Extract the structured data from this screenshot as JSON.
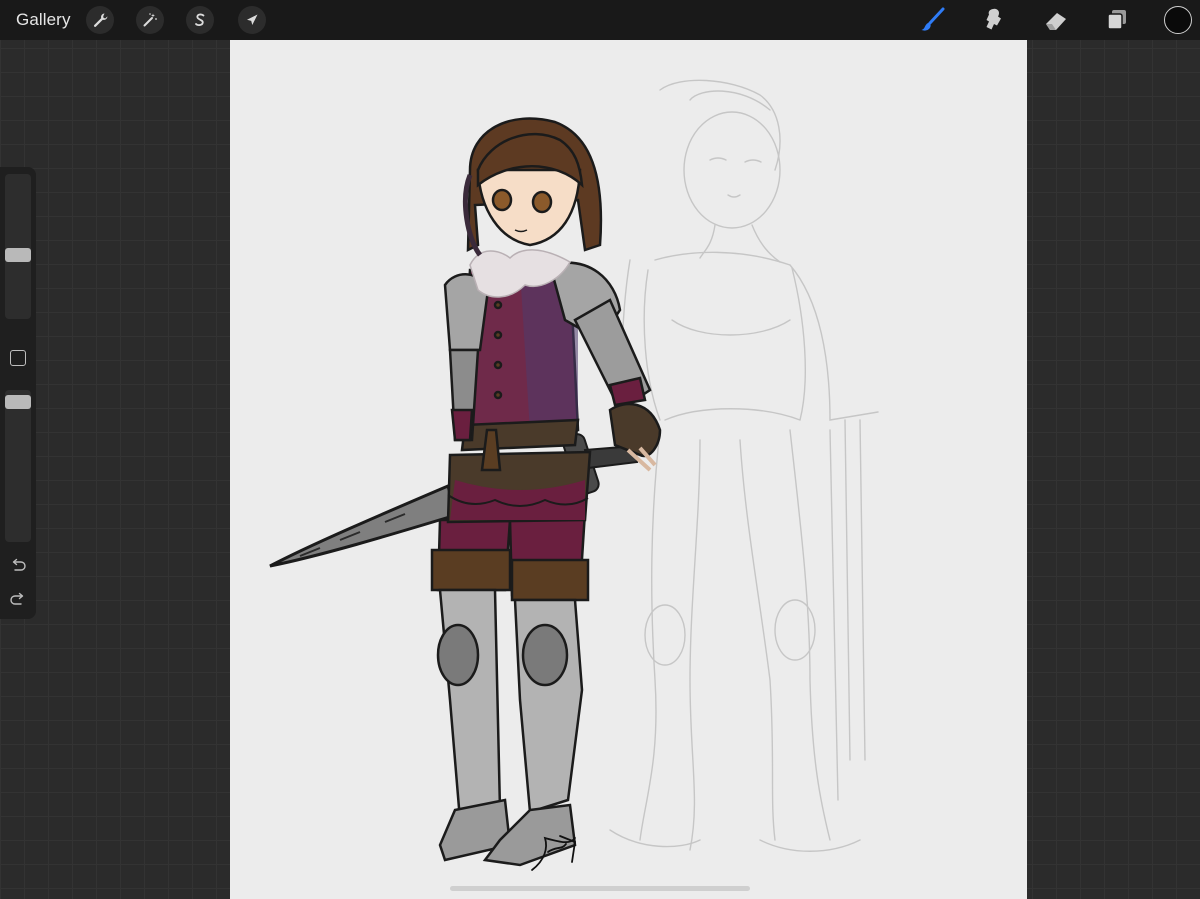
{
  "topbar": {
    "gallery_label": "Gallery",
    "left_tools": [
      "wrench-icon",
      "magic-wand-icon",
      "selection-s-icon",
      "transform-arrow-icon"
    ],
    "right_tools": [
      "brush-icon",
      "smudge-icon",
      "eraser-icon",
      "layers-icon"
    ],
    "active_tool": "brush-icon",
    "accent_color": "#2f7cf6",
    "current_color": "#0a0a0a"
  },
  "sidebar": {
    "brush_size_level": 0.45,
    "opacity_level": 0.95,
    "icons": [
      "modify-square-icon",
      "undo-icon",
      "redo-icon"
    ]
  },
  "canvas": {
    "background": "#ececec",
    "artwork": "character-illustration",
    "signature": "signature"
  }
}
